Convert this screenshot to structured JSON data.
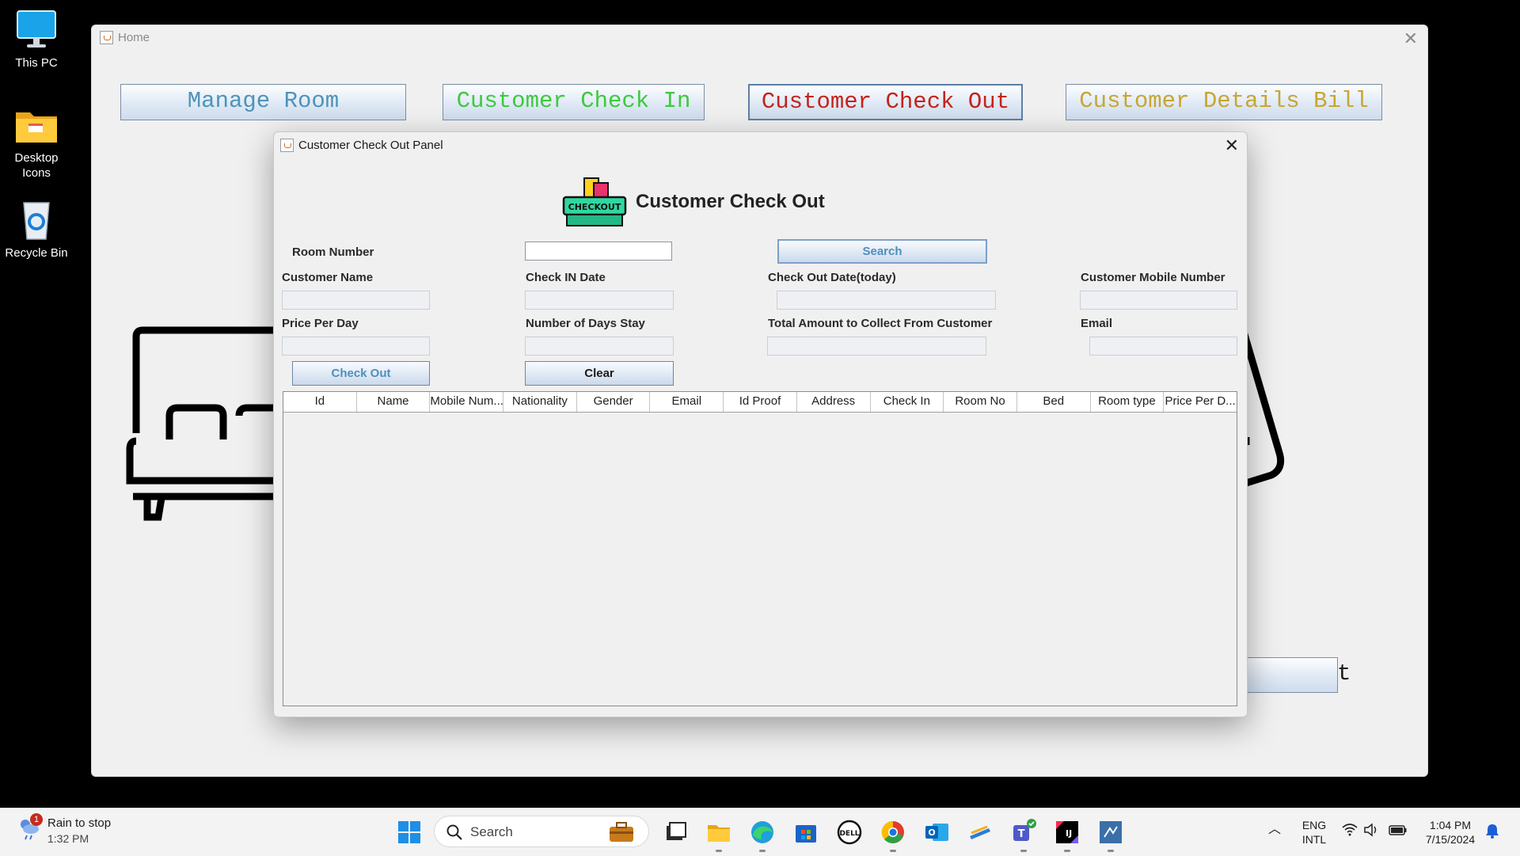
{
  "desktop": {
    "icons": [
      {
        "label": "This PC"
      },
      {
        "label": "Desktop Icons"
      },
      {
        "label": "Recycle Bin"
      }
    ]
  },
  "home_window": {
    "title": "Home",
    "nav": [
      {
        "label": "Manage Room",
        "color": "#4f93b8"
      },
      {
        "label": "Customer Check In",
        "color": "#3ec93e"
      },
      {
        "label": "Customer Check Out",
        "color": "#c4231c"
      },
      {
        "label": "Customer Details Bill",
        "color": "#c7a632"
      }
    ],
    "hidden_button_text": "t"
  },
  "dialog": {
    "title": "Customer Check Out Panel",
    "header": "Customer Check Out",
    "logo_text": "CHECKOUT",
    "labels": {
      "room_number": "Room Number",
      "customer_name": "Customer Name",
      "check_in_date": "Check IN Date",
      "check_out_date": "Check Out Date(today)",
      "customer_mobile": "Customer Mobile Number",
      "price_per_day": "Price Per Day",
      "days_stay": "Number of Days Stay",
      "total_amount": "Total Amount to Collect From Customer",
      "email": "Email"
    },
    "values": {
      "room_number": "",
      "customer_name": "",
      "check_in_date": "",
      "check_out_date": "",
      "customer_mobile": "",
      "price_per_day": "",
      "days_stay": "",
      "total_amount": "",
      "email": ""
    },
    "buttons": {
      "search": "Search",
      "check_out": "Check Out",
      "clear": "Clear"
    },
    "table": {
      "columns": [
        "Id",
        "Name",
        "Mobile Num...",
        "Nationality",
        "Gender",
        "Email",
        "Id Proof",
        "Address",
        "Check In",
        "Room No",
        "Bed",
        "Room type",
        "Price Per D..."
      ],
      "rows": []
    }
  },
  "taskbar": {
    "weather_title": "Rain to stop",
    "weather_time": "1:32 PM",
    "weather_badge": "1",
    "search_placeholder": "Search",
    "lang_line1": "ENG",
    "lang_line2": "INTL",
    "clock_time": "1:04 PM",
    "clock_date": "7/15/2024"
  }
}
